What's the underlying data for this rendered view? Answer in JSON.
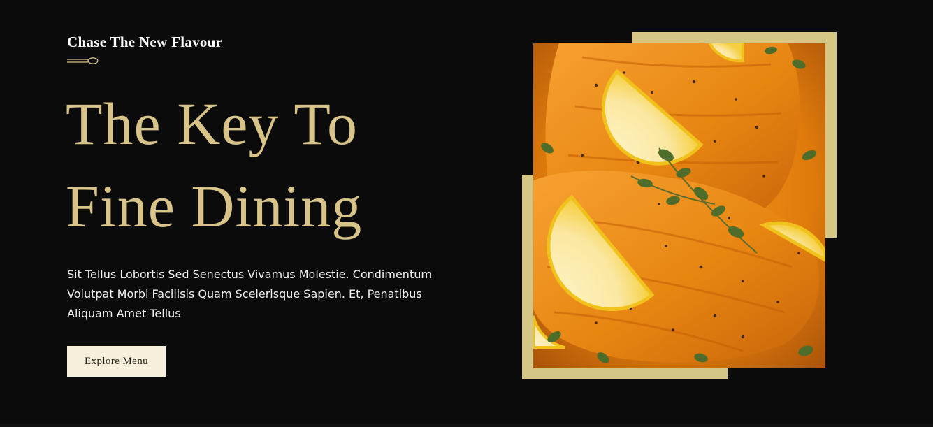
{
  "hero": {
    "tagline": "Chase The New Flavour",
    "headline_line1": "The Key To",
    "headline_line2": "Fine Dining",
    "description": "Sit Tellus Lobortis Sed Senectus Vivamus Molestie. Condimentum Volutpat Morbi Facilisis Quam Scelerisque Sapien. Et, Penatibus Aliquam Amet Tellus",
    "cta_label": "Explore Menu",
    "divider_icon": "spoon-icon",
    "photo_subject": "salmon-lemon-oregano"
  },
  "colors": {
    "background": "#0b0b0c",
    "accent_gold": "#d8c488",
    "frame_gold": "#d6c685",
    "button_bg": "#f7f0dd",
    "text_white": "#ffffff"
  }
}
